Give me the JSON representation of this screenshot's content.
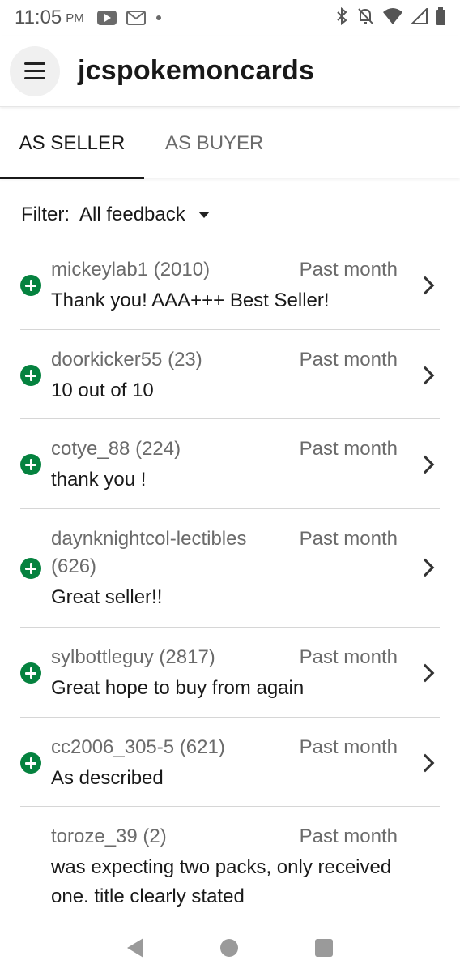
{
  "status_bar": {
    "time": "11:05",
    "ampm": "PM",
    "icons": [
      "youtube-icon",
      "gmail-icon",
      "notification-dot-icon",
      "bluetooth-icon",
      "mute-icon",
      "wifi-icon",
      "signal-icon",
      "battery-icon"
    ]
  },
  "app_bar": {
    "title": "jcspokemoncards"
  },
  "tabs": [
    {
      "label": "AS SELLER",
      "selected": true
    },
    {
      "label": "AS BUYER",
      "selected": false
    }
  ],
  "filter": {
    "label": "Filter:",
    "value": "All feedback"
  },
  "colors": {
    "positive": "#05823f",
    "text_primary": "#191919",
    "text_secondary": "#6b6b6b"
  },
  "feedback": [
    {
      "user": "mickeylab1 (2010)",
      "when": "Past month",
      "comment": "Thank you! AAA+++ Best Seller!",
      "rating": "positive"
    },
    {
      "user": "doorkicker55 (23)",
      "when": "Past month",
      "comment": "10 out of 10",
      "rating": "positive"
    },
    {
      "user": "cotye_88 (224)",
      "when": "Past month",
      "comment": "thank you !",
      "rating": "positive"
    },
    {
      "user": "daynknightcol-lectibles (626)",
      "when": "Past month",
      "comment": "Great seller!!",
      "rating": "positive"
    },
    {
      "user": "sylbottleguy (2817)",
      "when": "Past month",
      "comment": "Great hope to buy from again",
      "rating": "positive"
    },
    {
      "user": "cc2006_305-5 (621)",
      "when": "Past month",
      "comment": "As described",
      "rating": "positive"
    },
    {
      "user": "toroze_39 (2)",
      "when": "Past month",
      "comment": "was expecting two packs, only received one. title clearly stated",
      "rating": "none"
    }
  ]
}
